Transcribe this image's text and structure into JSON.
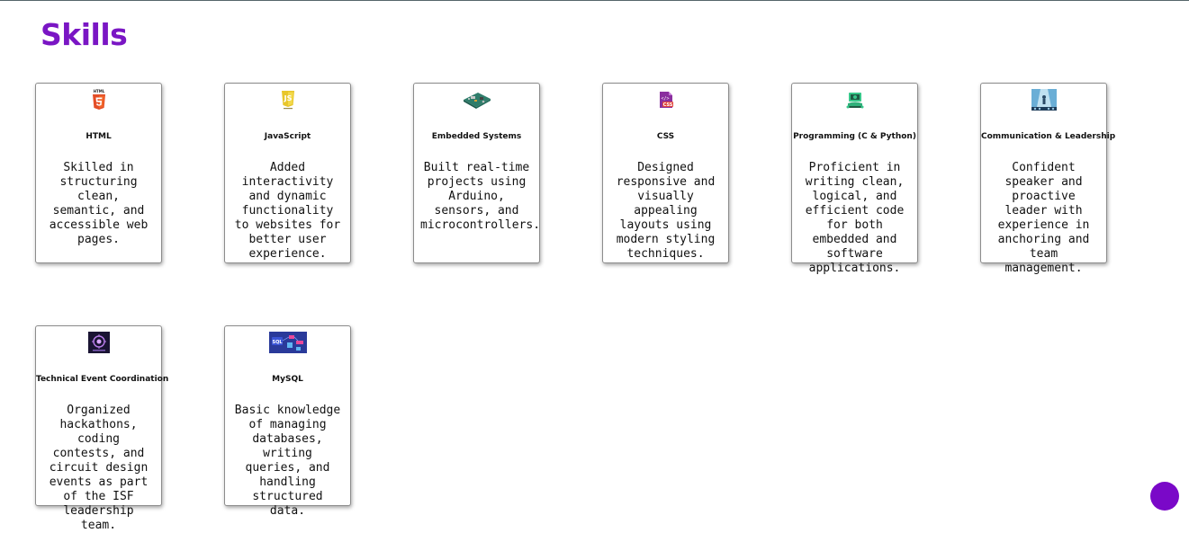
{
  "section": {
    "title": "Skills"
  },
  "skills": [
    {
      "name": "HTML",
      "icon": "html5-icon",
      "description": "Skilled in structuring clean, semantic, and accessible web pages."
    },
    {
      "name": "JavaScript",
      "icon": "javascript-icon",
      "description": "Added interactivity and dynamic functionality to websites for better user experience."
    },
    {
      "name": "Embedded Systems",
      "icon": "circuit-board-icon",
      "description": "Built real-time projects using Arduino, sensors, and microcontrollers."
    },
    {
      "name": "CSS",
      "icon": "css3-icon",
      "description": "Designed responsive and visually appealing layouts using modern styling techniques."
    },
    {
      "name": "Programming (C & Python)",
      "icon": "programmer-icon",
      "description": "Proficient in writing clean, logical, and efficient code for both embedded and software applications."
    },
    {
      "name": "Communication & Leadership",
      "icon": "speaker-stage-icon",
      "description": "Confident speaker and proactive leader with experience in anchoring and team management."
    },
    {
      "name": "Technical Event Coordination",
      "icon": "event-badge-icon",
      "description": "Organized hackathons, coding contests, and circuit design events as part of the ISF leadership team."
    },
    {
      "name": "MySQL",
      "icon": "sql-database-icon",
      "description": "Basic knowledge of managing databases, writing queries, and handling structured data."
    }
  ],
  "icon_labels": {
    "html": "HTML",
    "css": "CSS",
    "sql": "SQL"
  },
  "colors": {
    "title": "#7a16c4",
    "fab": "#7a08c8"
  }
}
